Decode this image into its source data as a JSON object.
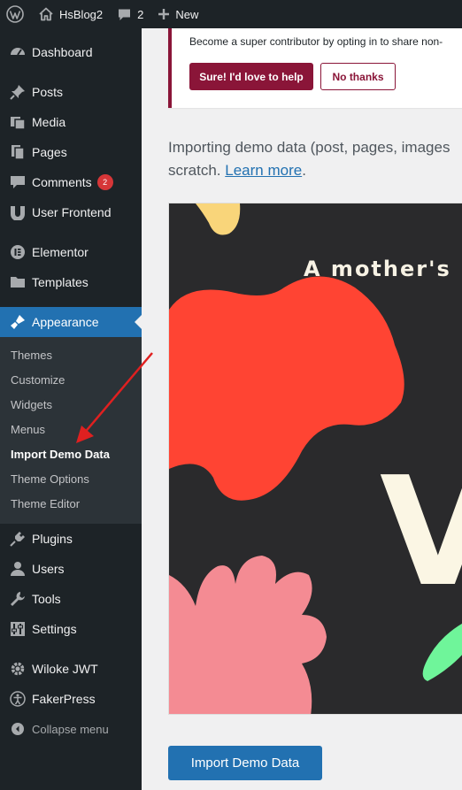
{
  "admin_bar": {
    "site_name": "HsBlog2",
    "comments_count": "2",
    "new_label": "New"
  },
  "sidebar": {
    "items": [
      {
        "key": "dashboard",
        "label": "Dashboard",
        "icon": "dashboard-icon"
      },
      {
        "key": "posts",
        "label": "Posts",
        "icon": "pin-icon"
      },
      {
        "key": "media",
        "label": "Media",
        "icon": "media-icon"
      },
      {
        "key": "pages",
        "label": "Pages",
        "icon": "pages-icon"
      },
      {
        "key": "comments",
        "label": "Comments",
        "icon": "comment-icon",
        "badge": "2"
      },
      {
        "key": "user-frontend",
        "label": "User Frontend",
        "icon": "user-frontend-icon"
      },
      {
        "key": "elementor",
        "label": "Elementor",
        "icon": "elementor-icon"
      },
      {
        "key": "templates",
        "label": "Templates",
        "icon": "folder-icon"
      },
      {
        "key": "appearance",
        "label": "Appearance",
        "icon": "brush-icon"
      },
      {
        "key": "plugins",
        "label": "Plugins",
        "icon": "plugin-icon"
      },
      {
        "key": "users",
        "label": "Users",
        "icon": "user-icon"
      },
      {
        "key": "tools",
        "label": "Tools",
        "icon": "wrench-icon"
      },
      {
        "key": "settings",
        "label": "Settings",
        "icon": "settings-icon"
      },
      {
        "key": "wiloke-jwt",
        "label": "Wiloke JWT",
        "icon": "gear-icon"
      },
      {
        "key": "fakerpress",
        "label": "FakerPress",
        "icon": "accessibility-icon"
      },
      {
        "key": "collapse",
        "label": "Collapse menu",
        "icon": "collapse-icon"
      }
    ],
    "submenu": [
      {
        "label": "Themes"
      },
      {
        "label": "Customize"
      },
      {
        "label": "Widgets"
      },
      {
        "label": "Menus"
      },
      {
        "label": "Import Demo Data",
        "active": true
      },
      {
        "label": "Theme Options"
      },
      {
        "label": "Theme Editor"
      }
    ]
  },
  "notice": {
    "text": "Become a super contributor by opting in to share non-",
    "accept_label": "Sure! I'd love to help",
    "decline_label": "No thanks"
  },
  "description": {
    "line1": "Importing demo data (post, pages, images",
    "line2_prefix": "scratch. ",
    "link_text": "Learn more",
    "line2_suffix": "."
  },
  "preview": {
    "heading": "A mother's",
    "big_letter": "V"
  },
  "import_button_label": "Import Demo Data",
  "colors": {
    "admin_dark": "#1d2327",
    "wp_blue": "#2271b1",
    "notice_accent": "#8a1538",
    "badge_red": "#d63638",
    "arrow_red": "#e02020"
  }
}
